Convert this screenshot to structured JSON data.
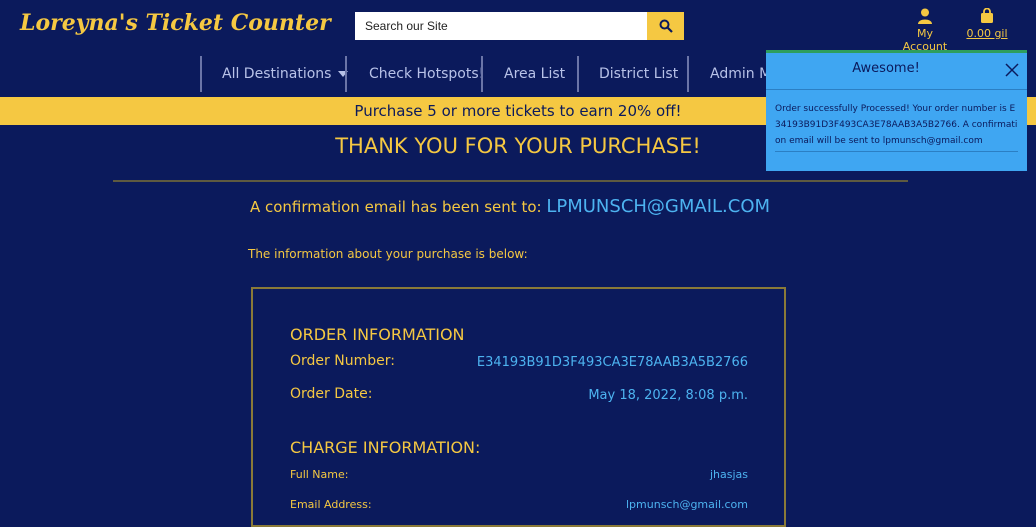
{
  "header": {
    "logo": "Loreyna's Ticket Counter",
    "search_placeholder": "Search our Site",
    "account_label": "My Account",
    "cart_label": "0.00 gil"
  },
  "nav": {
    "items": [
      "All Destinations",
      "Check Hotspots!",
      "Area List",
      "District List",
      "Admin Ma"
    ]
  },
  "promo": "Purchase 5 or more tickets to earn 20% off!",
  "main": {
    "thanks": "THANK YOU FOR YOUR PURCHASE!",
    "confirm_prefix": "A confirmation email has been sent to:",
    "confirm_email": "lpmunsch@gmail.com",
    "info_intro": "The information about your purchase is below:"
  },
  "order": {
    "section_title": "ORDER INFORMATION",
    "number_label": "Order Number:",
    "number_value": "E34193B91D3F493CA3E78AAB3A5B2766",
    "date_label": "Order Date:",
    "date_value": "May 18, 2022, 8:08 p.m."
  },
  "charge": {
    "section_title": "CHARGE INFORMATION:",
    "name_label": "Full Name:",
    "name_value": "jhasjas",
    "email_label": "Email Address:",
    "email_value": "lpmunsch@gmail.com"
  },
  "toast": {
    "title": "Awesome!",
    "message": "Order successfully Processed! Your order number is E34193B91D3F493CA3E78AAB3A5B2766. A confirmation email will be sent to lpmunsch@gmail.com"
  },
  "colors": {
    "background": "#0b1a5c",
    "accent": "#f5c842",
    "link": "#4db3f0",
    "toast": "#3fa6f2"
  }
}
